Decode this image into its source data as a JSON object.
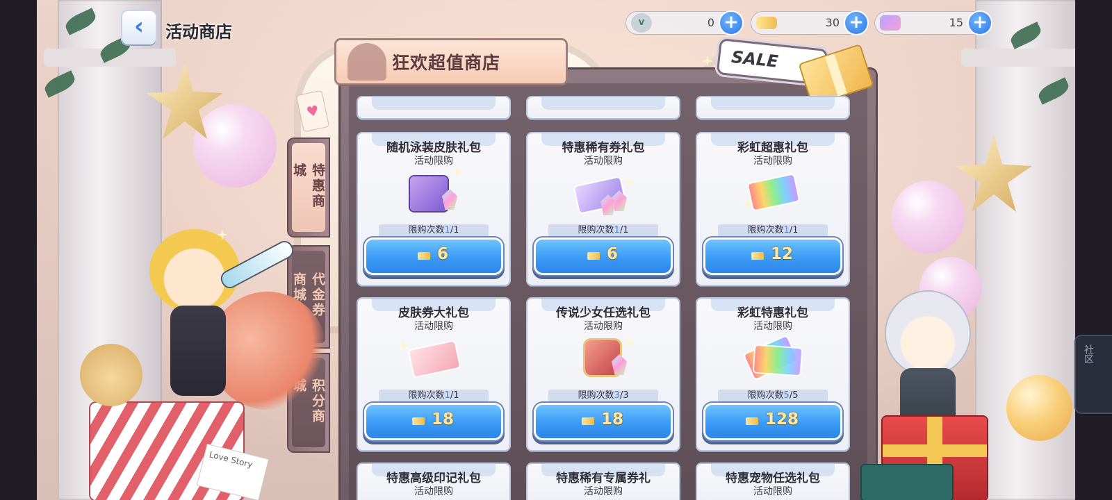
{
  "header": {
    "back_icon": "chevron-left-icon",
    "title": "活动商店"
  },
  "currencies": [
    {
      "icon": "v-coin-icon",
      "value": "0"
    },
    {
      "icon": "ticket-icon",
      "value": "30"
    },
    {
      "icon": "gem-card-icon",
      "value": "15"
    }
  ],
  "shop": {
    "title": "狂欢超值商店",
    "sale_label": "SALE"
  },
  "tabs": [
    {
      "label": "特惠商城",
      "active": true
    },
    {
      "label": "代金券商城",
      "active": false
    },
    {
      "label": "积分商城",
      "active": false
    }
  ],
  "products": [
    {
      "name": "随机泳装皮肤礼包",
      "sub": "活动限购",
      "limit_label": "限购次数",
      "bought": "1",
      "total": "/1",
      "price": "6"
    },
    {
      "name": "特惠稀有券礼包",
      "sub": "活动限购",
      "limit_label": "限购次数",
      "bought": "1",
      "total": "/1",
      "price": "6"
    },
    {
      "name": "彩虹超惠礼包",
      "sub": "活动限购",
      "limit_label": "限购次数",
      "bought": "1",
      "total": "/1",
      "price": "12"
    },
    {
      "name": "皮肤券大礼包",
      "sub": "活动限购",
      "limit_label": "限购次数",
      "bought": "1",
      "total": "/1",
      "price": "18"
    },
    {
      "name": "传说少女任选礼包",
      "sub": "活动限购",
      "limit_label": "限购次数",
      "bought": "3",
      "total": "/3",
      "price": "18"
    },
    {
      "name": "彩虹特惠礼包",
      "sub": "活动限购",
      "limit_label": "限购次数",
      "bought": "5",
      "total": "/5",
      "price": "128"
    },
    {
      "name": "特惠高级印记礼包",
      "sub": "活动限购"
    },
    {
      "name": "特惠稀有专属券礼",
      "sub": "活动限购"
    },
    {
      "name": "特惠宠物任选礼包",
      "sub": "活动限购"
    }
  ],
  "decor": {
    "love_card_text": "Love Story",
    "community_label": "社区"
  },
  "colors": {
    "buy_button": "#3b9bf5",
    "price_text": "#ffe9a8",
    "tab_active": "#f8dcd0",
    "tab_inactive": "#7b6168"
  }
}
